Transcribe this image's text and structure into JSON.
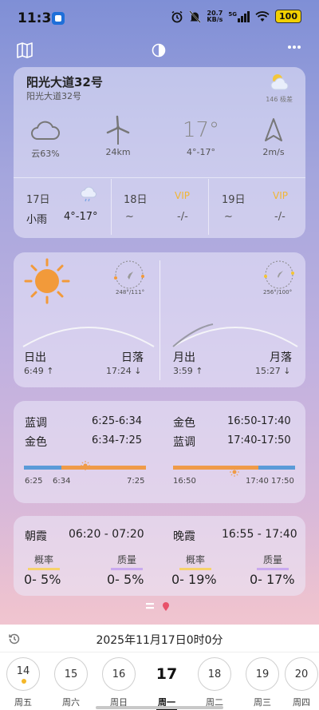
{
  "status_bar": {
    "time": "11:30",
    "net_speed_value": "20.7",
    "net_speed_unit": "KB/s",
    "signal_label": "5G",
    "battery": "100"
  },
  "location": {
    "title": "阳光大道32号",
    "subtitle": "阳光大道32号",
    "top_weather_label": "146 极差"
  },
  "current": {
    "cloud": "云63%",
    "wind_distance": "24km",
    "temp_big": "17°",
    "temp_range": "4°-17°",
    "wind_speed": "2m/s"
  },
  "forecast": [
    {
      "date": "17日",
      "condition": "小雨",
      "temp": "4°-17°"
    },
    {
      "date": "18日",
      "vip": "VIP",
      "condition": "~",
      "temp": "-/-"
    },
    {
      "date": "19日",
      "vip": "VIP",
      "condition": "~",
      "temp": "-/-"
    }
  ],
  "sun": {
    "compass_caption": "248°/111°",
    "rise_label": "日出",
    "set_label": "日落",
    "rise_time": "6:49 ↑",
    "set_time": "17:24 ↓"
  },
  "moon": {
    "compass_caption": "256°/100°",
    "rise_label": "月出",
    "set_label": "月落",
    "rise_time": "3:59 ↑",
    "set_time": "15:27 ↓"
  },
  "golden_blue": {
    "morning": [
      {
        "label": "蓝调",
        "time": "6:25-6:34"
      },
      {
        "label": "金色",
        "time": "6:34-7:25"
      }
    ],
    "evening": [
      {
        "label": "金色",
        "time": "16:50-17:40"
      },
      {
        "label": "蓝调",
        "time": "17:40-17:50"
      }
    ],
    "morning_bar_labels": [
      "6:25",
      "6:34",
      "7:25"
    ],
    "evening_bar_labels": [
      "16:50",
      "17:40",
      "17:50"
    ],
    "colors": {
      "blue": "#5b9bd8",
      "gold": "#ef9b48"
    }
  },
  "glow": {
    "morning_label": "朝霞",
    "morning_time": "06:20 - 07:20",
    "evening_label": "晚霞",
    "evening_time": "16:55 - 17:40",
    "items": [
      {
        "label": "概率",
        "value": "0- 5%"
      },
      {
        "label": "质量",
        "value": "0- 5%"
      },
      {
        "label": "概率",
        "value": "0- 19%"
      },
      {
        "label": "质量",
        "value": "0- 17%"
      }
    ]
  },
  "bottom": {
    "datetime": "2025年11月17日0时0分",
    "days": [
      {
        "num": "14",
        "week": "周五"
      },
      {
        "num": "15",
        "week": "周六"
      },
      {
        "num": "16",
        "week": "周日"
      },
      {
        "num": "17",
        "week": "周一"
      },
      {
        "num": "18",
        "week": "周二"
      },
      {
        "num": "19",
        "week": "周三"
      },
      {
        "num": "20",
        "week": "周四"
      }
    ]
  }
}
